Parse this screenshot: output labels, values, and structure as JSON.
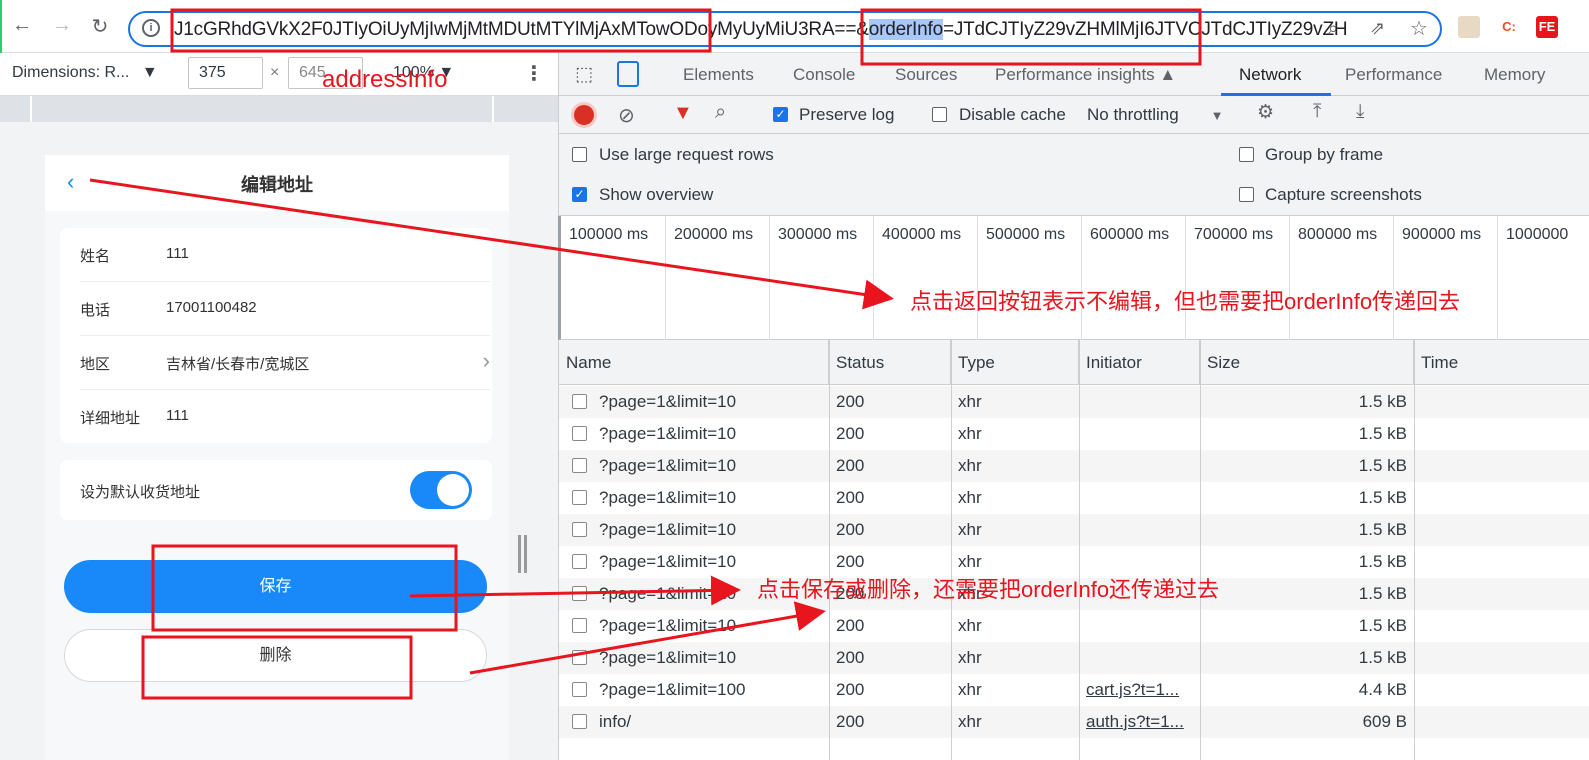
{
  "browser": {
    "url_part1": "J1cGRhdGVkX2F0JTIyOiUyMjIwMjMtMDUtMTYlMjAxMTowODoyMyUyMiU3RA==&",
    "url_highlight": "orderInfo",
    "url_part2": "=JTdCJTIyZ29vZHMlMjI6JTVCJTdCJTIyZ29vZH",
    "extensions": [
      "C:",
      "FE"
    ]
  },
  "device_toolbar": {
    "dimensions": "Dimensions: R...",
    "width": "375",
    "height": "645",
    "zoom": "100%"
  },
  "devtools": {
    "tabs": [
      "Elements",
      "Console",
      "Sources",
      "Performance insights",
      "Network",
      "Performance",
      "Memory"
    ],
    "active_tab": "Network",
    "preserve_log": "Preserve log",
    "disable_cache": "Disable cache",
    "throttling": "No throttling",
    "settings": {
      "large_rows": "Use large request rows",
      "show_overview": "Show overview",
      "group_by_frame": "Group by frame",
      "capture_screenshots": "Capture screenshots"
    },
    "timeline": [
      "100000 ms",
      "200000 ms",
      "300000 ms",
      "400000 ms",
      "500000 ms",
      "600000 ms",
      "700000 ms",
      "800000 ms",
      "900000 ms",
      "1000000"
    ],
    "columns": [
      "Name",
      "Status",
      "Type",
      "Initiator",
      "Size",
      "Time"
    ],
    "rows": [
      {
        "name": "?page=1&limit=10",
        "status": "200",
        "type": "xhr",
        "initiator": "",
        "size": "1.5 kB"
      },
      {
        "name": "?page=1&limit=10",
        "status": "200",
        "type": "xhr",
        "initiator": "",
        "size": "1.5 kB"
      },
      {
        "name": "?page=1&limit=10",
        "status": "200",
        "type": "xhr",
        "initiator": "",
        "size": "1.5 kB"
      },
      {
        "name": "?page=1&limit=10",
        "status": "200",
        "type": "xhr",
        "initiator": "",
        "size": "1.5 kB"
      },
      {
        "name": "?page=1&limit=10",
        "status": "200",
        "type": "xhr",
        "initiator": "",
        "size": "1.5 kB"
      },
      {
        "name": "?page=1&limit=10",
        "status": "200",
        "type": "xhr",
        "initiator": "",
        "size": "1.5 kB"
      },
      {
        "name": "?page=1&limit=10",
        "status": "200",
        "type": "xhr",
        "initiator": "",
        "size": "1.5 kB"
      },
      {
        "name": "?page=1&limit=10",
        "status": "200",
        "type": "xhr",
        "initiator": "",
        "size": "1.5 kB"
      },
      {
        "name": "?page=1&limit=10",
        "status": "200",
        "type": "xhr",
        "initiator": "",
        "size": "1.5 kB"
      },
      {
        "name": "?page=1&limit=100",
        "status": "200",
        "type": "xhr",
        "initiator": "cart.js?t=1...",
        "size": "4.4 kB"
      },
      {
        "name": "info/",
        "status": "200",
        "type": "xhr",
        "initiator": "auth.js?t=1...",
        "size": "609 B"
      }
    ]
  },
  "phone": {
    "title": "编辑地址",
    "fields": [
      {
        "label": "姓名",
        "value": "111"
      },
      {
        "label": "电话",
        "value": "17001100482"
      },
      {
        "label": "地区",
        "value": "吉林省/长春市/宽城区"
      },
      {
        "label": "详细地址",
        "value": "111"
      }
    ],
    "default_label": "设为默认收货地址",
    "default_on": true,
    "save": "保存",
    "delete": "删除"
  },
  "annotations": {
    "address_label": "addressInfo",
    "back_note": "点击返回按钮表示不编辑，但也需要把orderInfo传递回去",
    "save_note": "点击保存或删除，还需要把orderInfo还传递过去",
    "color": "#e8141e"
  }
}
